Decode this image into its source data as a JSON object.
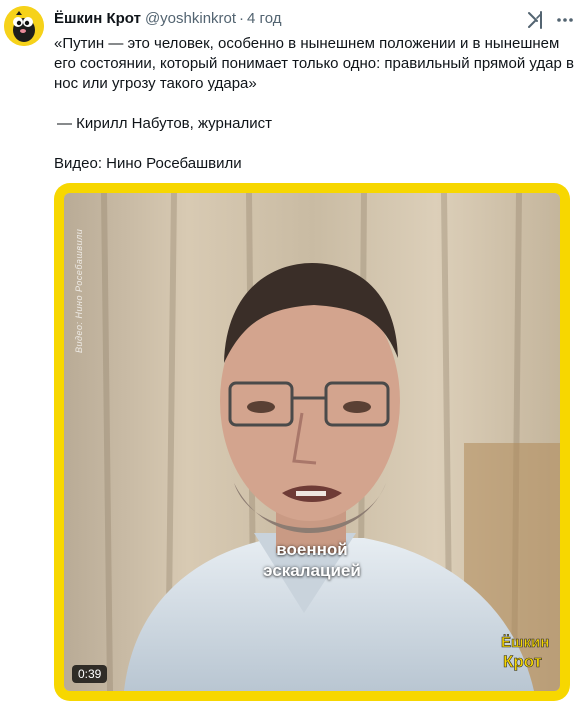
{
  "author": {
    "display_name": "Ёшкин Крот",
    "handle": "@yoshkinkrot",
    "separator": "·",
    "time": "4 год"
  },
  "tweet": {
    "quote": "«Путин — это человек, особенно в нынешнем положении и в нынешнем его состоянии, который понимает только одно: правильный прямой удар в нос или угрозу такого удара»",
    "attribution": "— Кирилл Набутов, журналист",
    "credit": "Видео: Нино Росебашвили"
  },
  "media": {
    "watermark": "Видео: Нино Росебашвили",
    "caption_line1": "военной",
    "caption_line2": "эскалацией",
    "logo_line1": "Ёшкин",
    "logo_line2": "Крот",
    "duration": "0:39",
    "frame_color": "#f7d700"
  },
  "icons": {
    "avatar": "mole-avatar-icon",
    "grok": "grok-icon",
    "more": "more-icon"
  },
  "colors": {
    "text": "#0f1419",
    "secondary": "#536471",
    "accent_yellow": "#f7d700"
  }
}
